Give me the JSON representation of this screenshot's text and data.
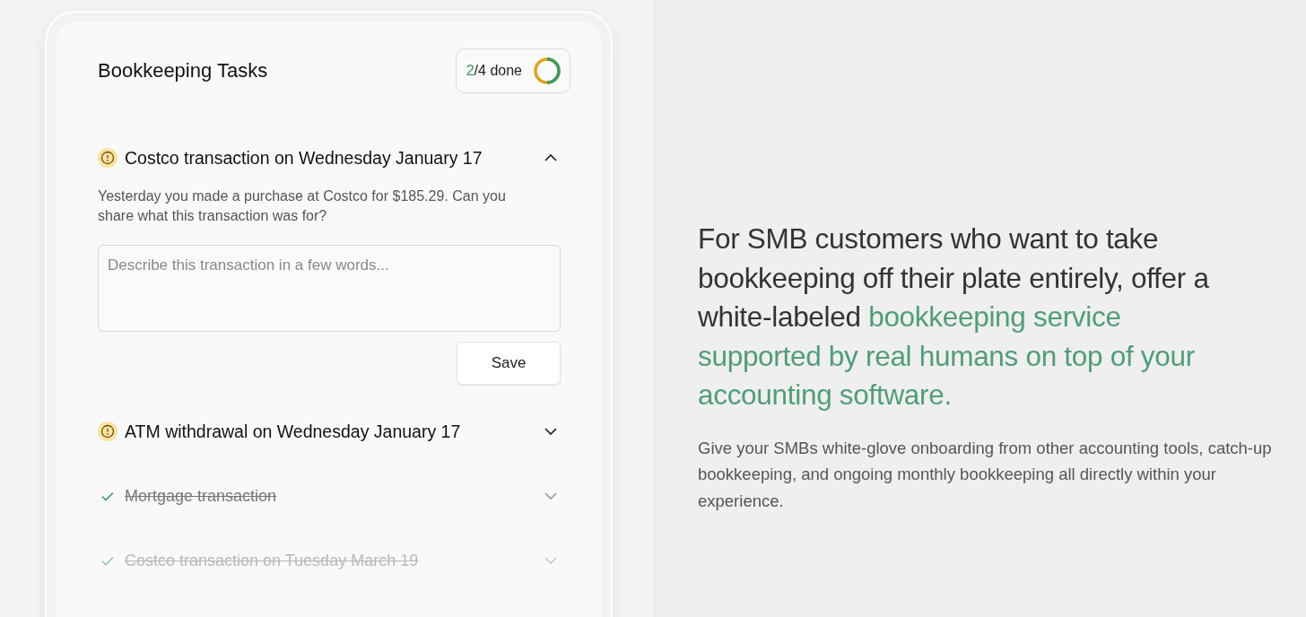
{
  "card": {
    "title": "Bookkeeping Tasks",
    "progress": {
      "count": "2",
      "rest": "/4 done",
      "level": 0.5
    },
    "tasks": [
      {
        "kind": "pending",
        "title": "Costco transaction on Wednesday January 17",
        "expanded": true,
        "description": "Yesterday you made a purchase at Costco for $185.29. Can you share what this transaction was for?",
        "placeholder": "Describe this transaction in a few words...",
        "button": "Save"
      },
      {
        "kind": "pending",
        "title": "ATM withdrawal on Wednesday January 17",
        "expanded": false
      },
      {
        "kind": "done",
        "title": "Mortgage transaction",
        "expanded": false
      },
      {
        "kind": "done",
        "title": "Costco transaction on Tuesday March 19",
        "expanded": false
      }
    ]
  },
  "pitch": {
    "headline": "For SMB customers who want to take bookkeeping off their plate entirely, offer a white-labeled",
    "highlight": "bookkeeping service supported by real humans on top of your accounting software.",
    "body": "Give your SMBs white-glove onboarding from other accounting tools, catch-up bookkeeping, and ongoing monthly bookkeeping all directly within your experience."
  }
}
